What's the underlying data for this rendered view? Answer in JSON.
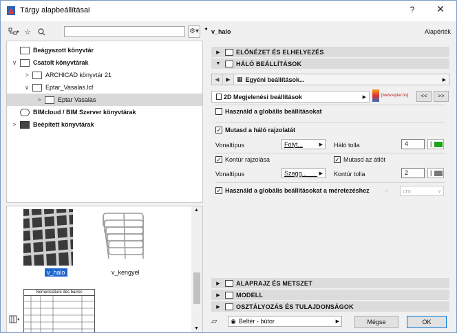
{
  "window": {
    "title": "Tárgy alapbeállításai",
    "help_label": "?",
    "close_label": "✕"
  },
  "left": {
    "search": {
      "value": "",
      "placeholder": ""
    },
    "tree": [
      {
        "label": "Beágyazott könyvtár",
        "bold": true,
        "level": 0,
        "expander": ""
      },
      {
        "label": "Csatolt könyvtárak",
        "bold": true,
        "level": 0,
        "expander": "∨"
      },
      {
        "label": "ARCHICAD könyvtár 21",
        "bold": false,
        "level": 1,
        "expander": ">"
      },
      {
        "label": "Eptar_Vasalas.lcf",
        "bold": false,
        "level": 1,
        "expander": "∨"
      },
      {
        "label": "Eptar Vasalas",
        "bold": false,
        "level": 2,
        "expander": ">",
        "selected": true
      },
      {
        "label": "BIMcloud / BIM Szerver könyvtárak",
        "bold": true,
        "level": 0,
        "expander": ""
      },
      {
        "label": "Beépített könyvtárak",
        "bold": true,
        "level": 0,
        "expander": ">"
      }
    ],
    "thumbs": [
      {
        "caption": "v_halo",
        "selected": true
      },
      {
        "caption": "v_kengyel",
        "selected": false
      },
      {
        "caption": "",
        "title_text": "Nomenclature des barres"
      }
    ]
  },
  "right": {
    "object_name": "v_halo",
    "default_label": "Alapérték",
    "sections": {
      "preview": "ELŐNÉZET ÉS ELHELYEZÉS",
      "mesh": "HÁLÓ BEÁLLÍTÁSOK",
      "floorplan": "ALAPRAJZ ÉS METSZET",
      "model": "MODELL",
      "classification": "OSZTÁLYOZÁS ÉS TULAJDONSÁGOK"
    },
    "custom_settings": "Egyéni beállítások...",
    "display_settings": "2D Megjelenési beállítások",
    "brand_url": "[www.eptar.hu]",
    "nav_prev": "<<",
    "nav_next": ">>",
    "use_global": "Használd a globális beállításokat",
    "show_mesh_lines": "Mutasd a háló rajzolatát",
    "linetype_label": "Vonaltípus",
    "linetype1": "Folyt...",
    "mesh_pen_label": "Háló tolla",
    "mesh_pen_value": "4",
    "contour_drawing": "Kontúr rajzolása",
    "show_diagonal": "Mutasd az átlót",
    "linetype2": "Szagg... _ _",
    "contour_pen_label": "Kontúr tolla",
    "contour_pen_value": "2",
    "global_dim": "Használd a globális beállításokat a méretezéshez",
    "unit": "cm"
  },
  "footer": {
    "layer": "Beltér - bútor",
    "cancel": "Mégse",
    "ok": "OK"
  },
  "colors": {
    "accent": "#1e66d0",
    "pen_green": "#1aa31a",
    "pen_gray": "#777777"
  }
}
